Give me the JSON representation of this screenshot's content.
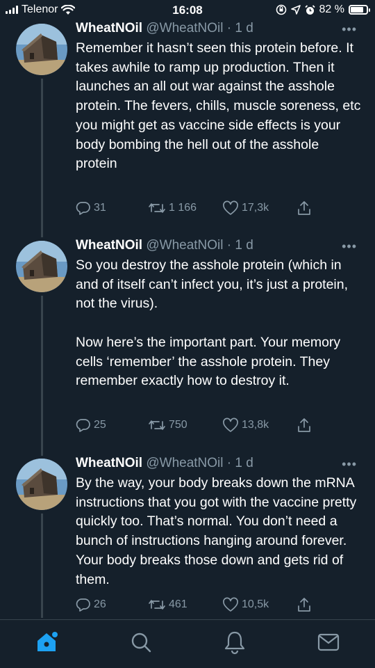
{
  "status_bar": {
    "carrier": "Telenor",
    "time": "16:08",
    "battery_percent": "82 %",
    "battery_level": 0.82
  },
  "tweets": [
    {
      "name": "WheatNOil",
      "handle": "@WheatNOil",
      "separator": "·",
      "time": "1 d",
      "more": "•••",
      "text": "Remember it hasn’t seen this protein before. It takes awhile to ramp up production. Then it launches an all out war against the asshole protein. The fevers, chills, muscle soreness, etc you might get as vaccine side effects is your body bombing the hell out of the asshole protein",
      "replies": "31",
      "retweets": "1 166",
      "likes": "17,3k"
    },
    {
      "name": "WheatNOil",
      "handle": "@WheatNOil",
      "separator": "·",
      "time": "1 d",
      "more": "•••",
      "text": "So you destroy the asshole protein (which in and of itself can’t infect you, it’s just a protein, not the virus).\n\nNow here’s the important part. Your memory cells ‘remember’ the asshole protein. They remember exactly how to destroy it.",
      "replies": "25",
      "retweets": "750",
      "likes": "13,8k"
    },
    {
      "name": "WheatNOil",
      "handle": "@WheatNOil",
      "separator": "·",
      "time": "1 d",
      "more": "•••",
      "text": "By the way, your body breaks down the mRNA instructions that you got with the vaccine pretty quickly too. That’s normal. You don’t need a bunch of instructions hanging around forever. Your body breaks those down and gets rid of them.",
      "replies": "26",
      "retweets": "461",
      "likes": "10,5k"
    }
  ],
  "tab_bar": {
    "items": [
      "home-icon",
      "search-icon",
      "notifications-icon",
      "messages-icon"
    ],
    "active_color": "#1da1f2",
    "inactive_color": "#8899a6"
  }
}
